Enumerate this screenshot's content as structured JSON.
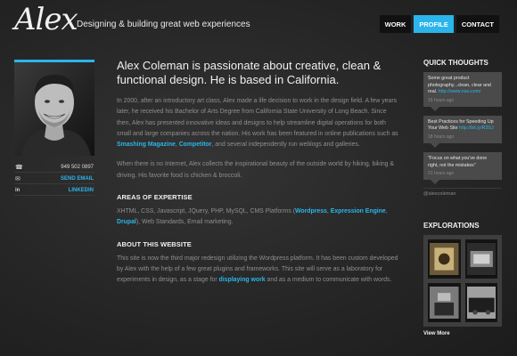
{
  "header": {
    "logo": "Alex",
    "tagline": "Designing & building great web experiences",
    "nav": [
      {
        "label": "WORK",
        "active": false
      },
      {
        "label": "PROFILE",
        "active": true
      },
      {
        "label": "CONTACT",
        "active": false
      }
    ]
  },
  "contact": {
    "phone": "949 502 0897",
    "email_label": "SEND EMAIL",
    "linkedin_label": "LINKEDIN"
  },
  "main": {
    "headline": "Alex Coleman is passionate about creative, clean & functional design. He is based in California.",
    "intro": {
      "before": "In 2000, after an introductory art class, Alex made a life decision to work in the design field. A few years later, he received his Bachelor of Arts Degree from California State University of Long Beach. Since then, Alex has presented innovative ideas and designs to help streamline digital operations for both small and large companies across the nation. His work has been featured in online publications such as ",
      "link1": "Smashing Magazine",
      "sep": ", ",
      "link2": "Competitor",
      "after": ", and several independently run weblogs and galleries."
    },
    "personal": "When there is no Internet, Alex collects the inspirational beauty of the outside world by hiking, biking & driving. His favorite food is chicken & broccoli.",
    "expertise_title": "AREAS OF EXPERTISE",
    "expertise": {
      "before": "XHTML, CSS, Javascript, JQuery, PHP, MySQL, CMS Platforms (",
      "link1": "Wordpress",
      "sep": ", ",
      "link2": "Expression Engine",
      "sep2": ", ",
      "link3": "Drupal",
      "after": "), Web Standards, Email marketing."
    },
    "about_title": "ABOUT THIS WEBSITE",
    "about": {
      "before": "This site is now the third major redesign utilizing the Wordpress platform. It has been custom developed by Alex with the help of a few great plugins and frameworks. This site will serve as a laboratory for experiments in design, as a stage for ",
      "link": "displaying work",
      "after": " and as a medium to communicate with words."
    }
  },
  "sidebar": {
    "thoughts_title": "QUICK THOUGHTS",
    "tweets": [
      {
        "text": "Some great product photography...clean, clear and real. ",
        "link": "http://www.nau.com/",
        "time": "16 hours ago"
      },
      {
        "text": "Best Practices for Speeding Up Your Web Site ",
        "link": "http://bit.ly/R3SJ",
        "time": "18 hours ago"
      },
      {
        "text": "\"Focus on what you've done right, not the mistakes\"",
        "link": "",
        "time": "21 hours ago"
      }
    ],
    "handle": "@alexcoleman",
    "explorations_title": "EXPLORATIONS",
    "view_more": "View More"
  },
  "colors": {
    "accent": "#2bb5ea",
    "background": "#2a2a2a",
    "tweet_bg": "#4a4a4a"
  }
}
